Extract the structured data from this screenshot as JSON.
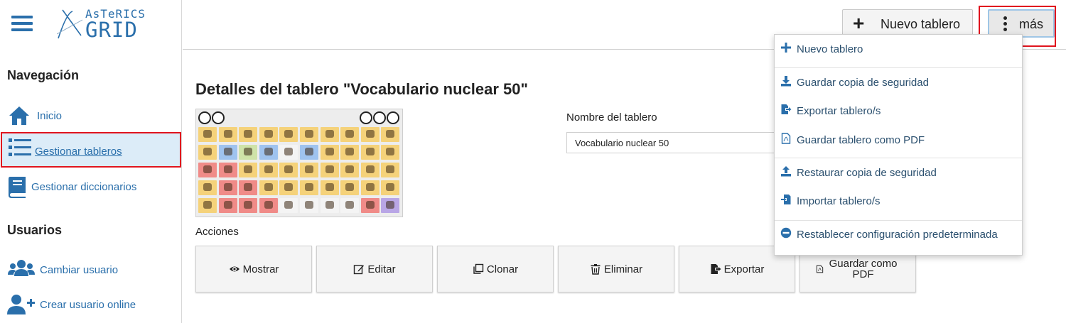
{
  "app": {
    "logo_top": "AsTeRICS",
    "logo_bottom": "GRID"
  },
  "sidebar": {
    "nav_title": "Navegación",
    "nav_items": [
      {
        "label": "Inicio",
        "icon": "home-icon"
      },
      {
        "label": "Gestionar tableros",
        "icon": "list-icon",
        "active": true
      },
      {
        "label": "Gestionar diccionarios",
        "icon": "book-icon"
      }
    ],
    "users_title": "Usuarios",
    "user_items": [
      {
        "label": "Cambiar usuario",
        "icon": "users-icon"
      },
      {
        "label": "Crear usuario online",
        "icon": "user-plus-icon"
      }
    ]
  },
  "header": {
    "new_board_label": "Nuevo tablero",
    "more_label": "más"
  },
  "main": {
    "title": "Detalles del tablero \"Vocabulario nuclear 50\"",
    "name_label": "Nombre del tablero",
    "name_value": "Vocabulario nuclear 50",
    "actions_label": "Acciones",
    "actions": [
      {
        "label": "Mostrar",
        "icon": "eye-icon"
      },
      {
        "label": "Editar",
        "icon": "edit-icon"
      },
      {
        "label": "Clonar",
        "icon": "clone-icon"
      },
      {
        "label": "Eliminar",
        "icon": "trash-icon"
      },
      {
        "label": "Exportar",
        "icon": "export-icon"
      },
      {
        "label": "Guardar como PDF",
        "icon": "pdf-icon"
      }
    ]
  },
  "dropdown": {
    "items": [
      {
        "label": "Nuevo tablero",
        "icon": "plus-icon"
      },
      {
        "label": "Guardar copia de seguridad",
        "icon": "download-icon"
      },
      {
        "label": "Exportar tablero/s",
        "icon": "file-export-icon"
      },
      {
        "label": "Guardar tablero como PDF",
        "icon": "file-pdf-icon"
      },
      {
        "label": "Restaurar copia de seguridad",
        "icon": "upload-icon"
      },
      {
        "label": "Importar tablero/s",
        "icon": "file-import-icon"
      },
      {
        "label": "Restablecer configuración predeterminada",
        "icon": "minus-circle-icon"
      }
    ]
  },
  "colors": {
    "accent": "#2a6fab",
    "highlight": "#e0141e",
    "active_bg": "#dcecf8"
  }
}
